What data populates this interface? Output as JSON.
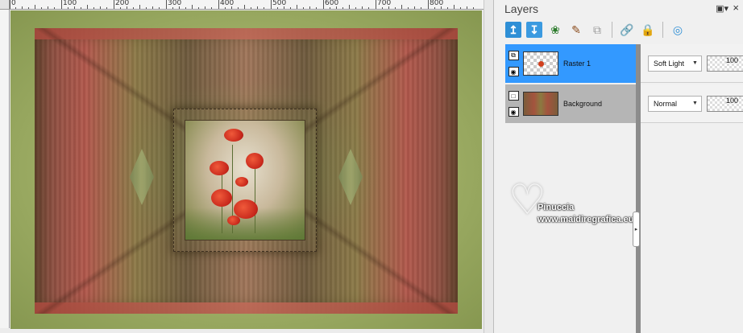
{
  "ruler": {
    "ticks": [
      "0",
      "100",
      "200",
      "300",
      "400",
      "500",
      "600",
      "700",
      "800"
    ]
  },
  "layers_panel": {
    "title": "Layers",
    "toolbar": [
      "new-raster-layer-icon",
      "new-vector-layer-icon",
      "add-mask-icon",
      "duplicate-icon",
      "merge-icon",
      "link-icon",
      "lock-icon",
      "effects-icon"
    ],
    "layers": [
      {
        "name": "Raster 1",
        "blend_mode": "Soft Light",
        "opacity": "100",
        "selected": true
      },
      {
        "name": "Background",
        "blend_mode": "Normal",
        "opacity": "100",
        "selected": false
      }
    ]
  },
  "watermark": {
    "name": "Pinuccia",
    "url": "www.maidiregrafica.eu"
  }
}
